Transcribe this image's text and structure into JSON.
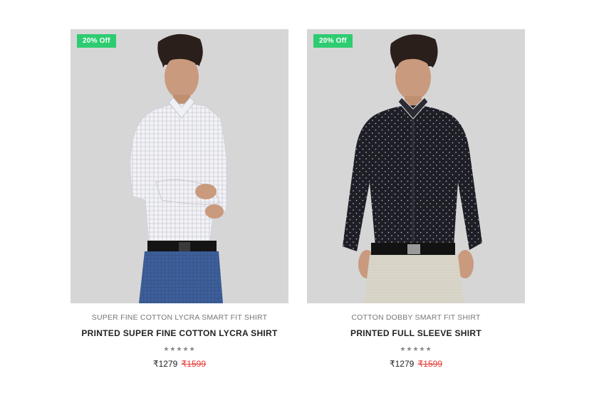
{
  "products": [
    {
      "badge": "20% Off",
      "subtitle": "SUPER FINE COTTON LYCRA SMART FIT SHIRT",
      "title": "PRINTED SUPER FINE COTTON LYCRA SHIRT",
      "rating_stars": "★★★★★",
      "price": "₹1279",
      "old_price": "₹1599",
      "shirt_color": "white-checked",
      "image_icon": "model-white-shirt-photo"
    },
    {
      "badge": "20% Off",
      "subtitle": "COTTON DOBBY SMART FIT SHIRT",
      "title": "PRINTED FULL SLEEVE SHIRT",
      "rating_stars": "★★★★★",
      "price": "₹1279",
      "old_price": "₹1599",
      "shirt_color": "black-dotted",
      "image_icon": "model-black-shirt-photo"
    }
  ],
  "colors": {
    "badge": "#2ecc71",
    "old_price": "#e53935",
    "image_bg": "#d6d6d6"
  }
}
